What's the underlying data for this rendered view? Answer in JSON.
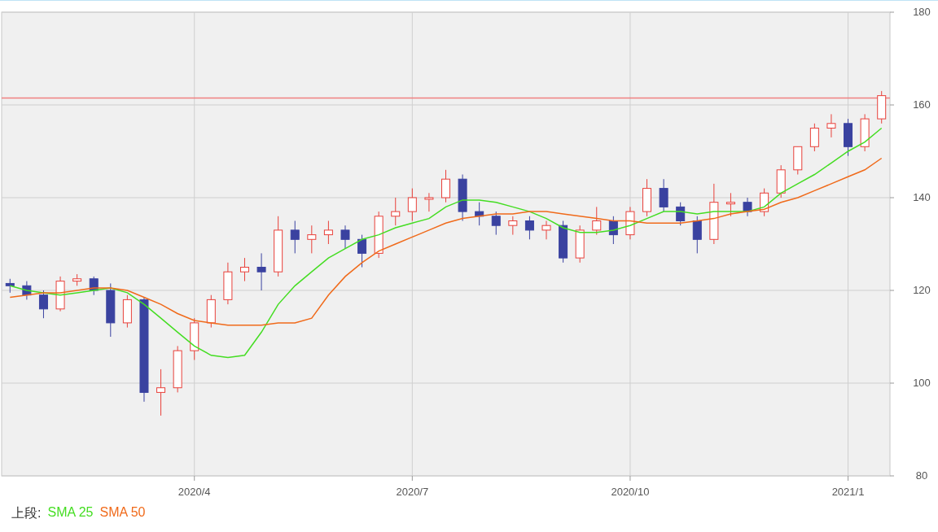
{
  "chart": {
    "chart_data": {
      "type": "candlestick",
      "categories": [
        null,
        null,
        null,
        null,
        null,
        null,
        null,
        null,
        null,
        null,
        null,
        "2020/4",
        null,
        null,
        null,
        null,
        null,
        null,
        null,
        null,
        null,
        null,
        null,
        null,
        "2020/7",
        null,
        null,
        null,
        null,
        null,
        null,
        null,
        null,
        null,
        null,
        null,
        null,
        "2020/10",
        null,
        null,
        null,
        null,
        null,
        null,
        null,
        null,
        null,
        null,
        null,
        null,
        "2021/1",
        null,
        null
      ],
      "ohlc": [
        [
          121.5,
          122.5,
          119.5,
          121
        ],
        [
          121,
          122,
          118,
          119
        ],
        [
          119,
          120,
          114,
          116
        ],
        [
          116,
          123,
          115.5,
          122
        ],
        [
          122,
          123.5,
          121,
          122.5
        ],
        [
          122.5,
          123,
          119,
          120
        ],
        [
          120,
          121.5,
          110,
          113
        ],
        [
          113,
          119,
          112,
          118
        ],
        [
          118,
          118.5,
          96,
          98
        ],
        [
          98,
          103,
          93,
          99
        ],
        [
          99,
          108,
          98,
          107
        ],
        [
          107,
          114,
          105,
          113
        ],
        [
          113,
          119,
          112,
          118
        ],
        [
          118,
          126,
          117,
          124
        ],
        [
          124,
          127,
          122,
          125
        ],
        [
          125,
          128,
          120,
          124
        ],
        [
          124,
          136,
          123,
          133
        ],
        [
          133,
          135,
          128,
          131
        ],
        [
          131,
          134,
          128,
          132
        ],
        [
          132,
          135,
          130,
          133
        ],
        [
          133,
          134,
          129,
          131
        ],
        [
          131,
          132,
          125,
          128
        ],
        [
          128,
          137,
          127,
          136
        ],
        [
          136,
          140,
          134,
          137
        ],
        [
          137,
          142,
          135,
          140
        ],
        [
          140,
          141,
          137,
          140
        ],
        [
          140,
          146,
          139,
          144
        ],
        [
          144,
          145,
          135,
          137
        ],
        [
          137,
          139,
          134,
          136
        ],
        [
          136,
          137,
          132,
          134
        ],
        [
          134,
          136,
          132,
          135
        ],
        [
          135,
          136,
          131,
          133
        ],
        [
          133,
          135,
          131,
          134
        ],
        [
          134,
          135,
          126,
          127
        ],
        [
          127,
          134,
          126,
          133
        ],
        [
          133,
          138,
          132,
          135
        ],
        [
          135,
          136,
          130,
          132
        ],
        [
          132,
          138,
          131,
          137
        ],
        [
          137,
          144,
          136,
          142
        ],
        [
          142,
          144,
          137,
          138
        ],
        [
          138,
          139,
          134,
          135
        ],
        [
          135,
          136,
          128,
          131
        ],
        [
          131,
          143,
          130,
          139
        ],
        [
          139,
          141,
          136,
          139
        ],
        [
          139,
          140,
          136,
          137
        ],
        [
          137,
          142,
          136,
          141
        ],
        [
          141,
          147,
          140,
          146
        ],
        [
          146,
          151,
          145,
          151
        ],
        [
          151,
          156,
          150,
          155
        ],
        [
          155,
          158,
          153,
          156
        ],
        [
          156,
          157,
          149,
          151
        ],
        [
          151,
          158,
          150,
          157
        ],
        [
          157,
          163,
          156,
          162
        ]
      ],
      "series": [
        {
          "name": "SMA 25",
          "type": "line",
          "color": "#44dd22",
          "values": [
            121,
            120,
            119.5,
            119,
            119.5,
            120,
            120.5,
            119.5,
            117,
            114,
            111,
            108,
            106,
            105.5,
            106,
            111,
            117,
            121,
            124,
            127,
            129,
            131,
            132,
            133.5,
            134.5,
            135.5,
            138,
            139.5,
            139.5,
            139,
            138,
            137,
            135.5,
            133.5,
            132.5,
            132.5,
            133,
            134,
            135.5,
            137,
            137,
            136.5,
            137,
            137,
            137,
            138,
            141,
            143,
            145,
            147.5,
            150,
            152,
            155
          ]
        },
        {
          "name": "SMA 50",
          "type": "line",
          "color": "#f06a1a",
          "values": [
            118.5,
            119,
            119.5,
            119.5,
            120,
            120.5,
            120.5,
            120,
            118.5,
            117,
            115,
            113.5,
            113,
            112.5,
            112.5,
            112.5,
            113,
            113,
            114,
            119,
            123,
            126,
            128.5,
            130,
            131.5,
            133,
            134.5,
            135.5,
            136,
            136.5,
            136.5,
            137,
            137,
            136.5,
            136,
            135.5,
            135,
            135,
            134.5,
            134.5,
            134.5,
            135,
            135.5,
            136.5,
            137,
            137.5,
            139,
            140,
            141.5,
            143,
            144.5,
            146,
            148.5
          ]
        }
      ],
      "ylim": [
        80,
        180
      ],
      "yticks": [
        80,
        100,
        120,
        140,
        160,
        180
      ],
      "grid": true,
      "ref_lines": [
        {
          "axis": "y",
          "value": 161.5,
          "color": "#f08080"
        }
      ]
    }
  },
  "legend": {
    "label": "上段:"
  }
}
